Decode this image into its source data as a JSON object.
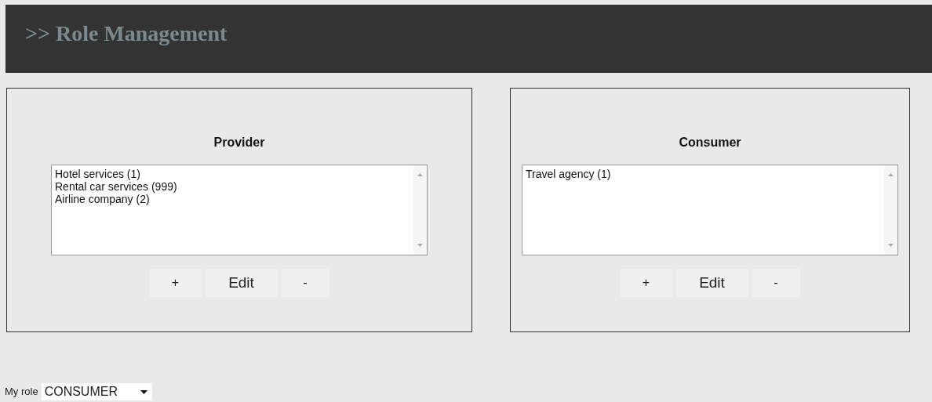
{
  "header": {
    "title": ">> Role Management"
  },
  "panels": [
    {
      "title": "Provider",
      "items": [
        "Hotel services (1)",
        "Rental car services (999)",
        "Airline company (2)"
      ],
      "buttons": [
        "+",
        "Edit",
        "-"
      ]
    },
    {
      "title": "Consumer",
      "items": [
        "Travel agency (1)"
      ],
      "buttons": [
        "+",
        "Edit",
        "-"
      ]
    }
  ],
  "role": {
    "label": "My role",
    "value": "CONSUMER"
  }
}
